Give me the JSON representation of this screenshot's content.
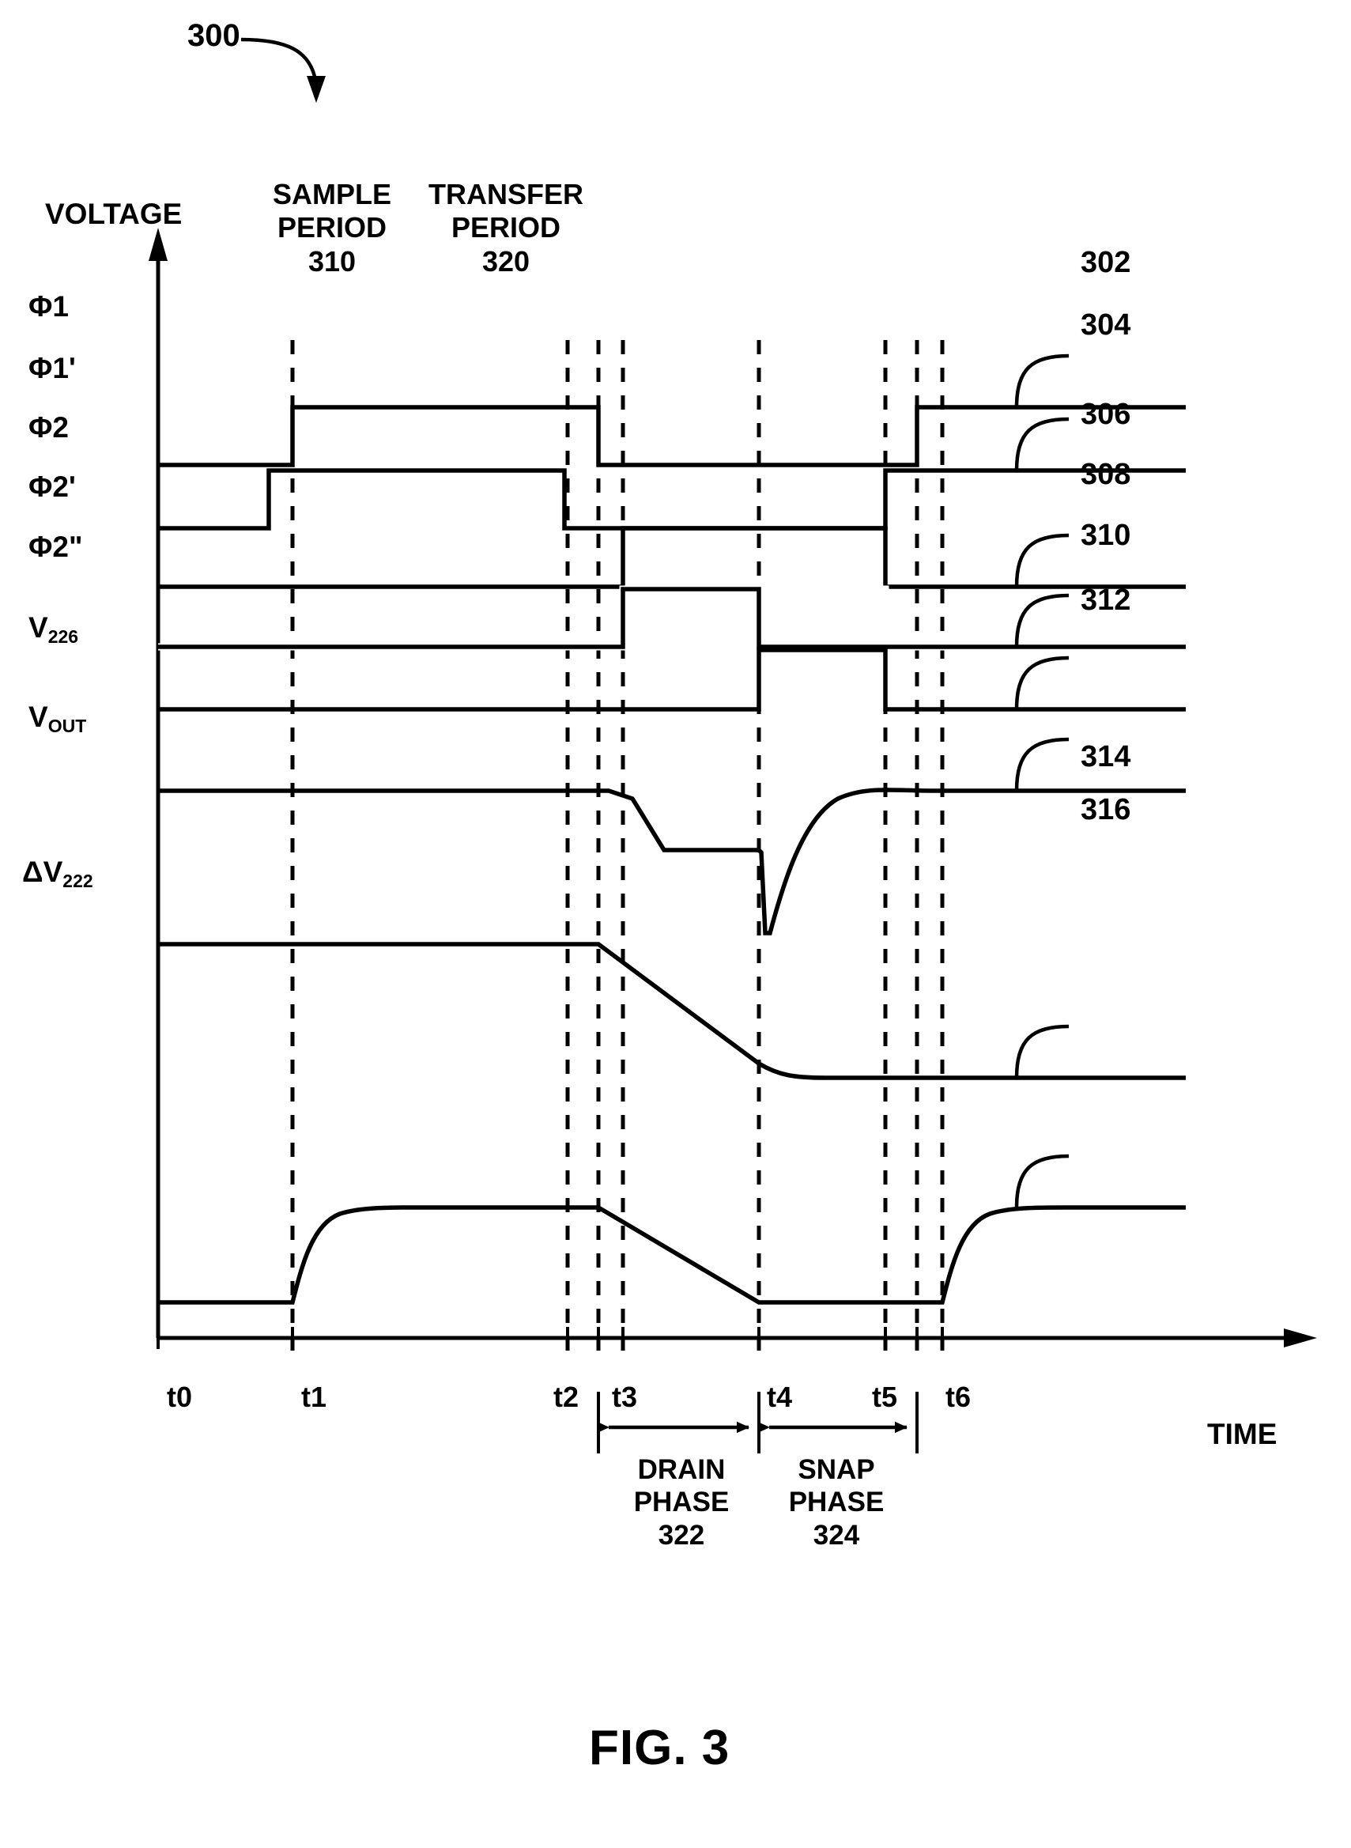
{
  "figure": {
    "ref_number": "300",
    "caption": "FIG. 3",
    "axis_y_label": "VOLTAGE",
    "axis_x_label": "TIME"
  },
  "periods": [
    {
      "id": "sample",
      "line1": "SAMPLE",
      "line2": "PERIOD",
      "number": "310"
    },
    {
      "id": "transfer",
      "line1": "TRANSFER",
      "line2": "PERIOD",
      "number": "320"
    }
  ],
  "phases": [
    {
      "id": "drain",
      "line1": "DRAIN",
      "line2": "PHASE",
      "number": "322"
    },
    {
      "id": "snap",
      "line1": "SNAP",
      "line2": "PHASE",
      "number": "324"
    }
  ],
  "signals": [
    {
      "id": "phi1",
      "label": "Φ1",
      "sub": "",
      "ref": "302"
    },
    {
      "id": "phi1p",
      "label": "Φ1'",
      "sub": "",
      "ref": "304"
    },
    {
      "id": "phi2",
      "label": "Φ2",
      "sub": "",
      "ref": "306"
    },
    {
      "id": "phi2p",
      "label": "Φ2'",
      "sub": "",
      "ref": "308"
    },
    {
      "id": "phi2pp",
      "label": "Φ2\"",
      "sub": "",
      "ref": "310"
    },
    {
      "id": "v226",
      "label": "V",
      "sub": "226",
      "ref": "312"
    },
    {
      "id": "vout",
      "label": "V",
      "sub": "OUT",
      "ref": "314"
    },
    {
      "id": "dv222",
      "label": "ΔV",
      "sub": "222",
      "ref": "316"
    }
  ],
  "time_marks": [
    "t0",
    "t1",
    "t2",
    "t3",
    "t4",
    "t5",
    "t6"
  ],
  "chart_data": {
    "type": "line",
    "title": "FIG. 3",
    "xlabel": "TIME",
    "ylabel": "VOLTAGE",
    "grid": false,
    "legend": "right-leader-numerals",
    "x_ticks": [
      "t0",
      "t1",
      "t2",
      "t3",
      "t4",
      "t5",
      "t6"
    ],
    "x_tick_positions": [
      200,
      370,
      718,
      765,
      960,
      1120,
      1185
    ],
    "series": [
      {
        "name": "Φ1",
        "ref": "302",
        "description": "logic high during sample period t1-t2, low during transfer, high again at t6",
        "points": [
          [
            200,
            0
          ],
          [
            370,
            0
          ],
          [
            370,
            1
          ],
          [
            718,
            1
          ],
          [
            718,
            0
          ],
          [
            1185,
            0
          ],
          [
            1185,
            1
          ],
          [
            1490,
            1
          ]
        ]
      },
      {
        "name": "Φ1'",
        "ref": "304",
        "description": "advanced version of Φ1: rises before t1, falls before t2, rises at t5",
        "points": [
          [
            200,
            0
          ],
          [
            340,
            0
          ],
          [
            340,
            1
          ],
          [
            700,
            1
          ],
          [
            700,
            0
          ],
          [
            1120,
            0
          ],
          [
            1120,
            1
          ],
          [
            1490,
            1
          ]
        ]
      },
      {
        "name": "Φ2",
        "ref": "306",
        "description": "high across the whole transfer period t3-t5",
        "points": [
          [
            200,
            0
          ],
          [
            765,
            0
          ],
          [
            765,
            1
          ],
          [
            1120,
            1
          ],
          [
            1120,
            0
          ],
          [
            1490,
            0
          ]
        ]
      },
      {
        "name": "Φ2'",
        "ref": "308",
        "description": "high only during the drain phase t3-t4",
        "points": [
          [
            200,
            0
          ],
          [
            765,
            0
          ],
          [
            765,
            1
          ],
          [
            960,
            1
          ],
          [
            960,
            0
          ],
          [
            1490,
            0
          ]
        ]
      },
      {
        "name": "Φ2\"",
        "ref": "310",
        "description": "high only during the snap phase t4-t5",
        "points": [
          [
            200,
            0
          ],
          [
            960,
            0
          ],
          [
            960,
            1
          ],
          [
            1120,
            1
          ],
          [
            1120,
            0
          ],
          [
            1490,
            0
          ]
        ]
      },
      {
        "name": "V226",
        "ref": "312",
        "description": "high until t3, ramps down to intermediate level, sharp negative spike at t4, exponential recovery to high level",
        "points": [
          [
            200,
            1
          ],
          [
            765,
            1
          ],
          [
            830,
            0.45
          ],
          [
            958,
            0.45
          ],
          [
            962,
            0
          ],
          [
            1050,
            0.85
          ],
          [
            1150,
            1
          ],
          [
            1490,
            1
          ]
        ]
      },
      {
        "name": "VOUT",
        "ref": "314",
        "description": "constant high until t3 then linear ramp down to a settled low level after t4",
        "points": [
          [
            200,
            1
          ],
          [
            758,
            1
          ],
          [
            960,
            0.12
          ],
          [
            1010,
            0.05
          ],
          [
            1490,
            0.05
          ]
        ]
      },
      {
        "name": "ΔV222",
        "ref": "316",
        "description": "low until t1, exponential rise to plateau, linear decay from t3 to t4, flat low until t5, exponential rise at t6",
        "points": [
          [
            200,
            0
          ],
          [
            370,
            0
          ],
          [
            430,
            0.82
          ],
          [
            520,
            0.88
          ],
          [
            758,
            0.88
          ],
          [
            960,
            0
          ],
          [
            1185,
            0
          ],
          [
            1215,
            0.85
          ],
          [
            1260,
            0.92
          ],
          [
            1490,
            0.92
          ]
        ]
      }
    ],
    "annotations": [
      {
        "text": "SAMPLE PERIOD 310",
        "span": [
          "t1",
          "t2"
        ]
      },
      {
        "text": "TRANSFER PERIOD 320",
        "span": [
          "t3",
          "t5"
        ]
      },
      {
        "text": "DRAIN PHASE 322",
        "span": [
          "t3",
          "t4"
        ]
      },
      {
        "text": "SNAP PHASE 324",
        "span": [
          "t4",
          "t5"
        ]
      }
    ]
  }
}
